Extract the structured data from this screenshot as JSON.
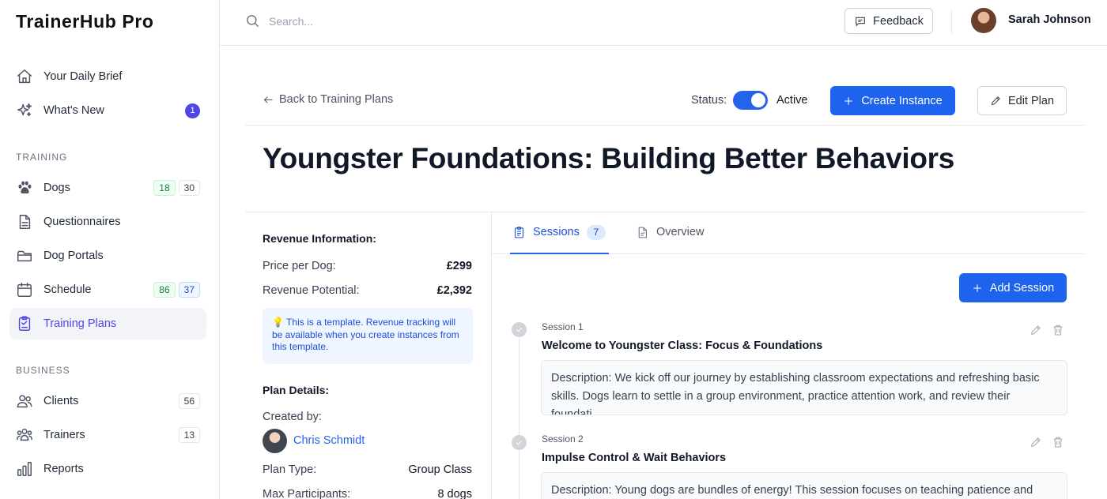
{
  "app": {
    "name": "TrainerHub Pro"
  },
  "sidebar": {
    "top_items": [
      {
        "label": "Your Daily Brief",
        "icon": "home-icon"
      },
      {
        "label": "What's New",
        "icon": "sparkles-icon",
        "badge": "1"
      }
    ],
    "training_heading": "TRAINING",
    "training_items": [
      {
        "label": "Dogs",
        "icon": "paw-icon",
        "count_a": "18",
        "count_b": "30"
      },
      {
        "label": "Questionnaires",
        "icon": "document-icon"
      },
      {
        "label": "Dog Portals",
        "icon": "folder-icon"
      },
      {
        "label": "Schedule",
        "icon": "calendar-icon",
        "count_a": "86",
        "count_b": "37"
      },
      {
        "label": "Training Plans",
        "icon": "clipboard-icon",
        "active": true
      }
    ],
    "business_heading": "BUSINESS",
    "business_items": [
      {
        "label": "Clients",
        "icon": "users-icon",
        "count": "56"
      },
      {
        "label": "Trainers",
        "icon": "team-icon",
        "count": "13"
      },
      {
        "label": "Reports",
        "icon": "bar-chart-icon"
      }
    ]
  },
  "header": {
    "search_placeholder": "Search...",
    "feedback_label": "Feedback",
    "user_name": "Sarah Johnson"
  },
  "plan": {
    "back_label": "Back to Training Plans",
    "status_label": "Status:",
    "status_value": "Active",
    "status_on": true,
    "create_instance_label": "Create Instance",
    "edit_plan_label": "Edit Plan",
    "title": "Youngster Foundations: Building Better Behaviors"
  },
  "revenue": {
    "heading": "Revenue Information:",
    "price_label": "Price per Dog:",
    "price_value": "£299",
    "potential_label": "Revenue Potential:",
    "potential_value": "£2,392",
    "note": "💡 This is a template. Revenue tracking will be available when you create instances from this template."
  },
  "details": {
    "heading": "Plan Details:",
    "created_by_label": "Created by:",
    "creator_name": "Chris Schmidt",
    "plan_type_label": "Plan Type:",
    "plan_type_value": "Group Class",
    "max_participants_label": "Max Participants:",
    "max_participants_value": "8 dogs"
  },
  "tabs": [
    {
      "label": "Sessions",
      "count": "7",
      "active": true,
      "icon": "clipboard-list-icon"
    },
    {
      "label": "Overview",
      "active": false,
      "icon": "file-icon"
    }
  ],
  "add_session_label": "Add Session",
  "sessions": [
    {
      "number": "Session 1",
      "title": "Welcome to Youngster Class: Focus & Foundations",
      "description": "Description: We kick off our journey by establishing classroom expectations and refreshing basic skills. Dogs learn to settle in a group environment, practice attention work, and review their foundati…"
    },
    {
      "number": "Session 2",
      "title": "Impulse Control & Wait Behaviors",
      "description": "Description: Young dogs are bundles of energy! This session focuses on teaching patience and self-"
    }
  ],
  "colors": {
    "primary": "#1d63ed",
    "accent": "#4f46e5",
    "active_link": "#2563eb"
  }
}
